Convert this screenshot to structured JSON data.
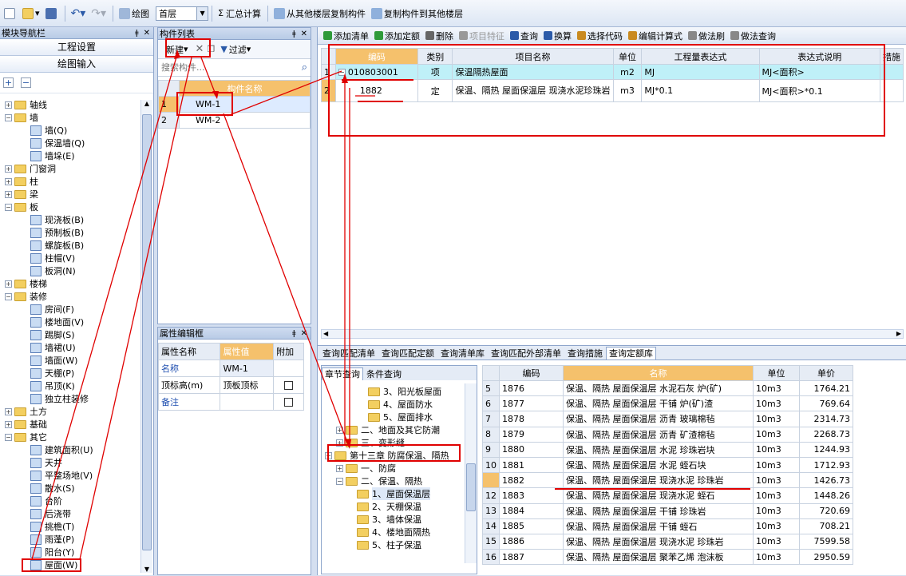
{
  "toolbar": {
    "draw": "绘图",
    "floor": "首层",
    "sum": "汇总计算",
    "copy_from": "从其他楼层复制构件",
    "copy_to": "复制构件到其他楼层"
  },
  "nav": {
    "title": "模块导航栏",
    "btn1": "工程设置",
    "btn2": "绘图输入",
    "tree": [
      {
        "label": "轴线",
        "level": 0,
        "exp": "+",
        "type": "folder"
      },
      {
        "label": "墙",
        "level": 0,
        "exp": "-",
        "type": "folder"
      },
      {
        "label": "墙(Q)",
        "level": 1,
        "type": "leaf"
      },
      {
        "label": "保温墙(Q)",
        "level": 1,
        "type": "leaf"
      },
      {
        "label": "墙垛(E)",
        "level": 1,
        "type": "leaf"
      },
      {
        "label": "门窗洞",
        "level": 0,
        "exp": "+",
        "type": "folder"
      },
      {
        "label": "柱",
        "level": 0,
        "exp": "+",
        "type": "folder"
      },
      {
        "label": "梁",
        "level": 0,
        "exp": "+",
        "type": "folder"
      },
      {
        "label": "板",
        "level": 0,
        "exp": "-",
        "type": "folder"
      },
      {
        "label": "现浇板(B)",
        "level": 1,
        "type": "leaf"
      },
      {
        "label": "预制板(B)",
        "level": 1,
        "type": "leaf"
      },
      {
        "label": "螺旋板(B)",
        "level": 1,
        "type": "leaf"
      },
      {
        "label": "柱帽(V)",
        "level": 1,
        "type": "leaf"
      },
      {
        "label": "板洞(N)",
        "level": 1,
        "type": "leaf"
      },
      {
        "label": "楼梯",
        "level": 0,
        "exp": "+",
        "type": "folder"
      },
      {
        "label": "装修",
        "level": 0,
        "exp": "-",
        "type": "folder"
      },
      {
        "label": "房间(F)",
        "level": 1,
        "type": "leaf"
      },
      {
        "label": "楼地面(V)",
        "level": 1,
        "type": "leaf"
      },
      {
        "label": "踢脚(S)",
        "level": 1,
        "type": "leaf"
      },
      {
        "label": "墙裙(U)",
        "level": 1,
        "type": "leaf"
      },
      {
        "label": "墙面(W)",
        "level": 1,
        "type": "leaf"
      },
      {
        "label": "天棚(P)",
        "level": 1,
        "type": "leaf"
      },
      {
        "label": "吊顶(K)",
        "level": 1,
        "type": "leaf"
      },
      {
        "label": "独立柱装修",
        "level": 1,
        "type": "leaf"
      },
      {
        "label": "土方",
        "level": 0,
        "exp": "+",
        "type": "folder"
      },
      {
        "label": "基础",
        "level": 0,
        "exp": "+",
        "type": "folder"
      },
      {
        "label": "其它",
        "level": 0,
        "exp": "-",
        "type": "folder"
      },
      {
        "label": "建筑面积(U)",
        "level": 1,
        "type": "leaf"
      },
      {
        "label": "天井",
        "level": 1,
        "type": "leaf"
      },
      {
        "label": "平整场地(V)",
        "level": 1,
        "type": "leaf"
      },
      {
        "label": "散水(S)",
        "level": 1,
        "type": "leaf"
      },
      {
        "label": "台阶",
        "level": 1,
        "type": "leaf"
      },
      {
        "label": "后浇带",
        "level": 1,
        "type": "leaf"
      },
      {
        "label": "挑檐(T)",
        "level": 1,
        "type": "leaf"
      },
      {
        "label": "雨蓬(P)",
        "level": 1,
        "type": "leaf"
      },
      {
        "label": "阳台(Y)",
        "level": 1,
        "type": "leaf"
      },
      {
        "label": "屋面(W)",
        "level": 1,
        "type": "leaf"
      }
    ]
  },
  "comp": {
    "title": "构件列表",
    "new_btn": "新建",
    "filter_btn": "过滤",
    "search_placeholder": "搜索构件...",
    "col_name": "构件名称",
    "rows": [
      {
        "n": "1",
        "name": "WM-1"
      },
      {
        "n": "2",
        "name": "WM-2"
      }
    ]
  },
  "prop": {
    "title": "属性编辑框",
    "headers": [
      "属性名称",
      "属性值",
      "附加"
    ],
    "rows": [
      {
        "name": "名称",
        "value": "WM-1",
        "blue": true,
        "check": false
      },
      {
        "name": "顶标高(m)",
        "value": "顶板顶标",
        "blue": false,
        "check": true
      },
      {
        "name": "备注",
        "value": "",
        "blue": true,
        "check": true
      }
    ]
  },
  "rtool": {
    "items": [
      "添加清单",
      "添加定额",
      "删除",
      "项目特征",
      "查询",
      "换算",
      "选择代码",
      "编辑计算式",
      "做法刷",
      "做法查询"
    ]
  },
  "grid": {
    "headers": [
      "编码",
      "类别",
      "项目名称",
      "单位",
      "工程量表达式",
      "表达式说明",
      "措施"
    ],
    "rows": [
      {
        "n": "1",
        "code": "010803001",
        "type": "项",
        "name": "保温隔热屋面",
        "unit": "m2",
        "expr": "MJ",
        "desc": "MJ<面积>"
      },
      {
        "n": "2",
        "code": "1882",
        "type": "定",
        "name": "保温、隔热 屋面保温层 现浇水泥珍珠岩",
        "unit": "m3",
        "expr": "MJ*0.1",
        "desc": "MJ<面积>*0.1"
      }
    ]
  },
  "btabs": [
    "查询匹配清单",
    "查询匹配定额",
    "查询清单库",
    "查询匹配外部清单",
    "查询措施",
    "查询定额库"
  ],
  "ctabs": [
    "章节查询",
    "条件查询"
  ],
  "chap": [
    {
      "label": "3、阳光板屋面",
      "level": 3
    },
    {
      "label": "4、屋面防水",
      "level": 3
    },
    {
      "label": "5、屋面排水",
      "level": 3
    },
    {
      "label": "二、地面及其它防潮",
      "level": 1,
      "exp": "+"
    },
    {
      "label": "三、变形缝",
      "level": 1,
      "exp": "+"
    },
    {
      "label": "第十三章 防腐保温、隔热",
      "level": 0,
      "exp": "-"
    },
    {
      "label": "一、防腐",
      "level": 1,
      "exp": "+"
    },
    {
      "label": "二、保温、隔热",
      "level": 1,
      "exp": "-"
    },
    {
      "label": "1、屋面保温层",
      "level": 2
    },
    {
      "label": "2、天棚保温",
      "level": 2
    },
    {
      "label": "3、墙体保温",
      "level": 2
    },
    {
      "label": "4、楼地面隔热",
      "level": 2
    },
    {
      "label": "5、柱子保温",
      "level": 2
    }
  ],
  "quota": {
    "headers": [
      "编码",
      "名称",
      "单位",
      "单价"
    ],
    "rows": [
      {
        "n": "5",
        "code": "1876",
        "name": "保温、隔热 屋面保温层 水泥石灰 炉(矿)",
        "unit": "10m3",
        "price": "1764.21"
      },
      {
        "n": "6",
        "code": "1877",
        "name": "保温、隔热 屋面保温层 干铺 炉(矿)渣",
        "unit": "10m3",
        "price": "769.64"
      },
      {
        "n": "7",
        "code": "1878",
        "name": "保温、隔热 屋面保温层 沥青 玻璃棉毡",
        "unit": "10m3",
        "price": "2314.73"
      },
      {
        "n": "8",
        "code": "1879",
        "name": "保温、隔热 屋面保温层 沥青 矿渣棉毡",
        "unit": "10m3",
        "price": "2268.73"
      },
      {
        "n": "9",
        "code": "1880",
        "name": "保温、隔热 屋面保温层 水泥 珍珠岩块",
        "unit": "10m3",
        "price": "1244.93"
      },
      {
        "n": "10",
        "code": "1881",
        "name": "保温、隔热 屋面保温层 水泥 蛭石块",
        "unit": "10m3",
        "price": "1712.93"
      },
      {
        "n": "11",
        "code": "1882",
        "name": "保温、隔热 屋面保温层 现浇水泥 珍珠岩",
        "unit": "10m3",
        "price": "1426.73"
      },
      {
        "n": "12",
        "code": "1883",
        "name": "保温、隔热 屋面保温层 现浇水泥 蛭石",
        "unit": "10m3",
        "price": "1448.26"
      },
      {
        "n": "13",
        "code": "1884",
        "name": "保温、隔热 屋面保温层 干铺 珍珠岩",
        "unit": "10m3",
        "price": "720.69"
      },
      {
        "n": "14",
        "code": "1885",
        "name": "保温、隔热 屋面保温层 干铺 蛭石",
        "unit": "10m3",
        "price": "708.21"
      },
      {
        "n": "15",
        "code": "1886",
        "name": "保温、隔热 屋面保温层 现浇水泥 珍珠岩",
        "unit": "10m3",
        "price": "7599.58"
      },
      {
        "n": "16",
        "code": "1887",
        "name": "保温、隔热 屋面保温层 聚苯乙烯 泡沫板",
        "unit": "10m3",
        "price": "2950.59"
      }
    ]
  },
  "colors": {
    "accent": "#f5c16c",
    "highlight": "#bff0f8",
    "annotation": "#e00000"
  }
}
